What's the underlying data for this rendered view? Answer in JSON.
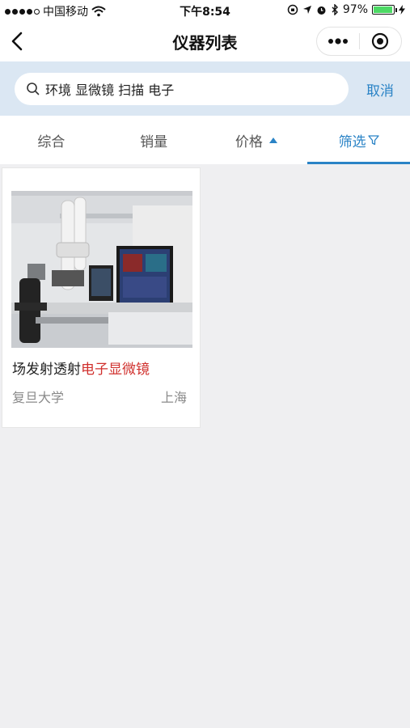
{
  "status_bar": {
    "carrier": "中国移动",
    "time": "下午8:54",
    "battery": "97%",
    "battery_level": 0.97
  },
  "nav": {
    "title": "仪器列表",
    "back_icon": "chevron-left-icon",
    "more_icon": "more-dots-icon",
    "close_icon": "target-circle-icon"
  },
  "search": {
    "query": "环境 显微镜 扫描 电子",
    "cancel_label": "取消"
  },
  "tabs": [
    {
      "label": "综合"
    },
    {
      "label": "销量"
    },
    {
      "label": "价格"
    },
    {
      "label": "筛选"
    }
  ],
  "colors": {
    "accent": "#2a83c6",
    "highlight": "#d0302d",
    "search_bg": "#dbe7f3"
  },
  "results": [
    {
      "title_prefix": "场发射透射",
      "title_highlight": "电子显微镜",
      "organization": "复旦大学",
      "city": "上海"
    }
  ]
}
